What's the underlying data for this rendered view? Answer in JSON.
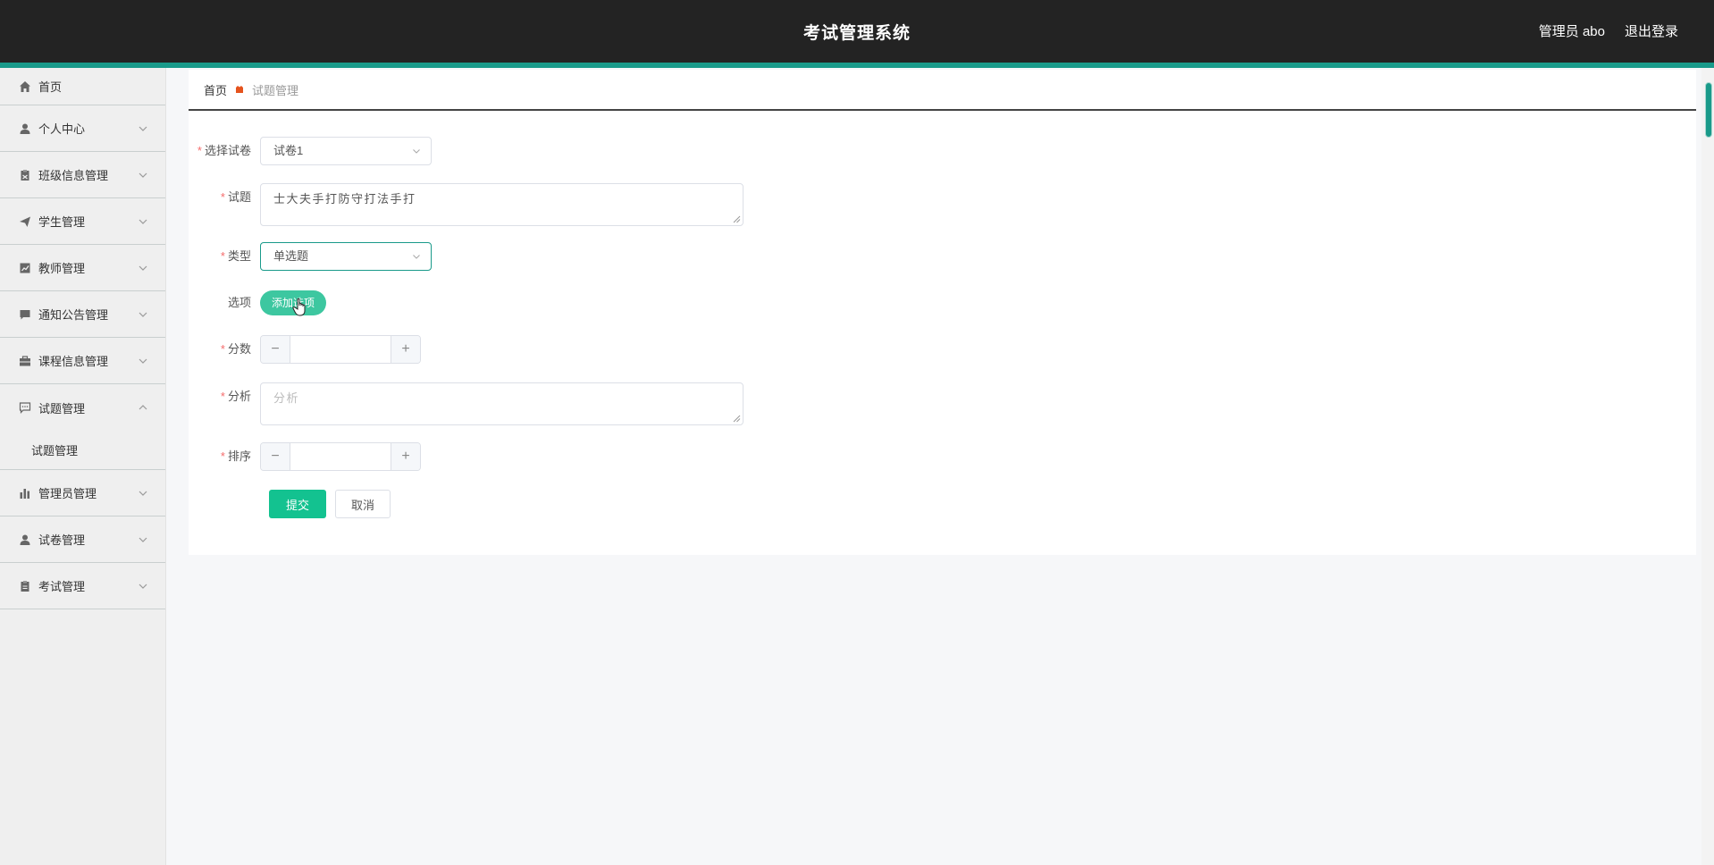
{
  "header": {
    "title": "考试管理系统",
    "user_label": "管理员 abo",
    "logout_label": "退出登录"
  },
  "sidebar": {
    "items": [
      {
        "label": "首页",
        "icon": "home-icon"
      },
      {
        "label": "个人中心",
        "icon": "user-icon"
      },
      {
        "label": "班级信息管理",
        "icon": "clipboard-icon"
      },
      {
        "label": "学生管理",
        "icon": "paper-plane-icon"
      },
      {
        "label": "教师管理",
        "icon": "chart-box-icon"
      },
      {
        "label": "通知公告管理",
        "icon": "message-icon"
      },
      {
        "label": "课程信息管理",
        "icon": "briefcase-icon"
      },
      {
        "label": "试题管理",
        "icon": "chat-icon",
        "expanded": true,
        "children": [
          "试题管理"
        ]
      },
      {
        "label": "管理员管理",
        "icon": "bar-chart-icon"
      },
      {
        "label": "试卷管理",
        "icon": "user-icon"
      },
      {
        "label": "考试管理",
        "icon": "clipboard-icon"
      }
    ]
  },
  "breadcrumb": {
    "home": "首页",
    "current": "试题管理"
  },
  "form": {
    "paper": {
      "label": "选择试卷",
      "value": "试卷1"
    },
    "question": {
      "label": "试题",
      "value": "士大夫手打防守打法手打"
    },
    "type": {
      "label": "类型",
      "value": "单选题"
    },
    "options": {
      "label": "选项",
      "button": "添加选项"
    },
    "score": {
      "label": "分数",
      "value": ""
    },
    "analysis": {
      "label": "分析",
      "placeholder": "分析"
    },
    "order": {
      "label": "排序",
      "value": ""
    },
    "submit_label": "提交",
    "cancel_label": "取消"
  },
  "colors": {
    "header_bg": "#232323",
    "accent": "#199a8a",
    "primary_button": "#13c290",
    "pill_button": "#3dc7a0",
    "required": "#f56c6c"
  }
}
